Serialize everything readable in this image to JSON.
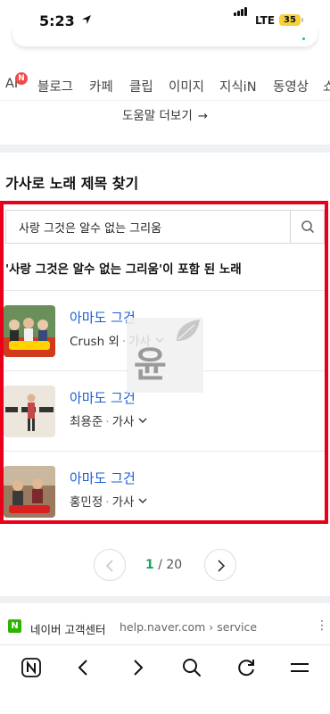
{
  "status_bar": {
    "time": "5:23",
    "network": "LTE",
    "battery": "35"
  },
  "tabs": [
    {
      "label": "AI",
      "badge": "N"
    },
    {
      "label": "블로그"
    },
    {
      "label": "카페"
    },
    {
      "label": "클립"
    },
    {
      "label": "이미지"
    },
    {
      "label": "지식iN"
    },
    {
      "label": "동영상"
    },
    {
      "label": "쇼"
    }
  ],
  "help": {
    "label": "도움말 더보기",
    "arrow": "→"
  },
  "lyrics": {
    "section_title": "가사로 노래 제목 찾기",
    "search": {
      "value": "사랑 그것은 알수 없는 그리움"
    },
    "result_title": "'사랑 그것은 알수 없는 그리움'이 포함 된 노래",
    "songs": [
      {
        "title": "아마도 그건",
        "artist": "Crush 외",
        "tag": "가사"
      },
      {
        "title": "아마도 그건",
        "artist": "최용준",
        "tag": "가사"
      },
      {
        "title": "아마도 그건",
        "artist": "홍민정",
        "tag": "가사"
      }
    ],
    "watermark": "윤"
  },
  "pagination": {
    "current": "1",
    "separator": "/",
    "total": "20"
  },
  "next_result": {
    "logo": "N",
    "site": "네이버 고객센터",
    "url": "help.naver.com › service",
    "more": "⋮"
  },
  "toolbar": {
    "home_logo": "N"
  },
  "colors": {
    "accent_red": "#e8001b",
    "link_blue": "#1a5ed4",
    "naver_green": "#18a55a"
  }
}
